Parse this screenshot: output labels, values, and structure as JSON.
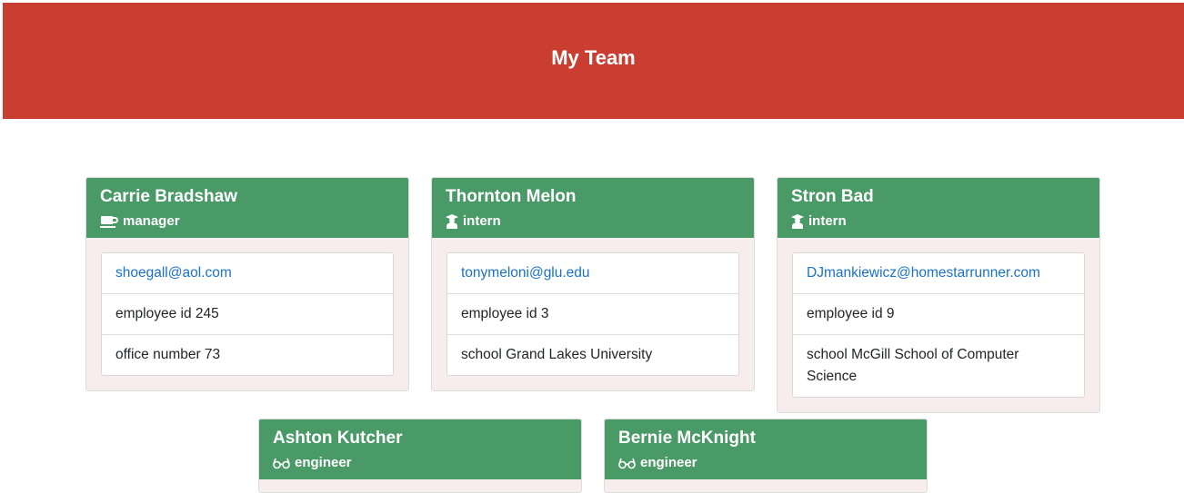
{
  "header": {
    "title": "My Team"
  },
  "employees": [
    {
      "name": "Carrie Bradshaw",
      "role": "manager",
      "role_icon": "coffee-icon",
      "email": "shoegall@aol.com",
      "id_text": "employee id 245",
      "extra_text": "office number 73"
    },
    {
      "name": "Thornton Melon",
      "role": "intern",
      "role_icon": "graduate-icon",
      "email": "tonymeloni@glu.edu",
      "id_text": "employee id 3",
      "extra_text": "school Grand Lakes University"
    },
    {
      "name": "Stron Bad",
      "role": "intern",
      "role_icon": "graduate-icon",
      "email": "DJmankiewicz@homestarrunner.com",
      "id_text": "employee id 9",
      "extra_text": "school McGill School of Computer Science"
    },
    {
      "name": "Ashton Kutcher",
      "role": "engineer",
      "role_icon": "glasses-icon"
    },
    {
      "name": "Bernie McKnight",
      "role": "engineer",
      "role_icon": "glasses-icon"
    }
  ],
  "colors": {
    "header_bg": "#c93e31",
    "card_head_bg": "#4a9a68",
    "card_body_bg": "#f8eded",
    "link": "#1a72c8"
  }
}
